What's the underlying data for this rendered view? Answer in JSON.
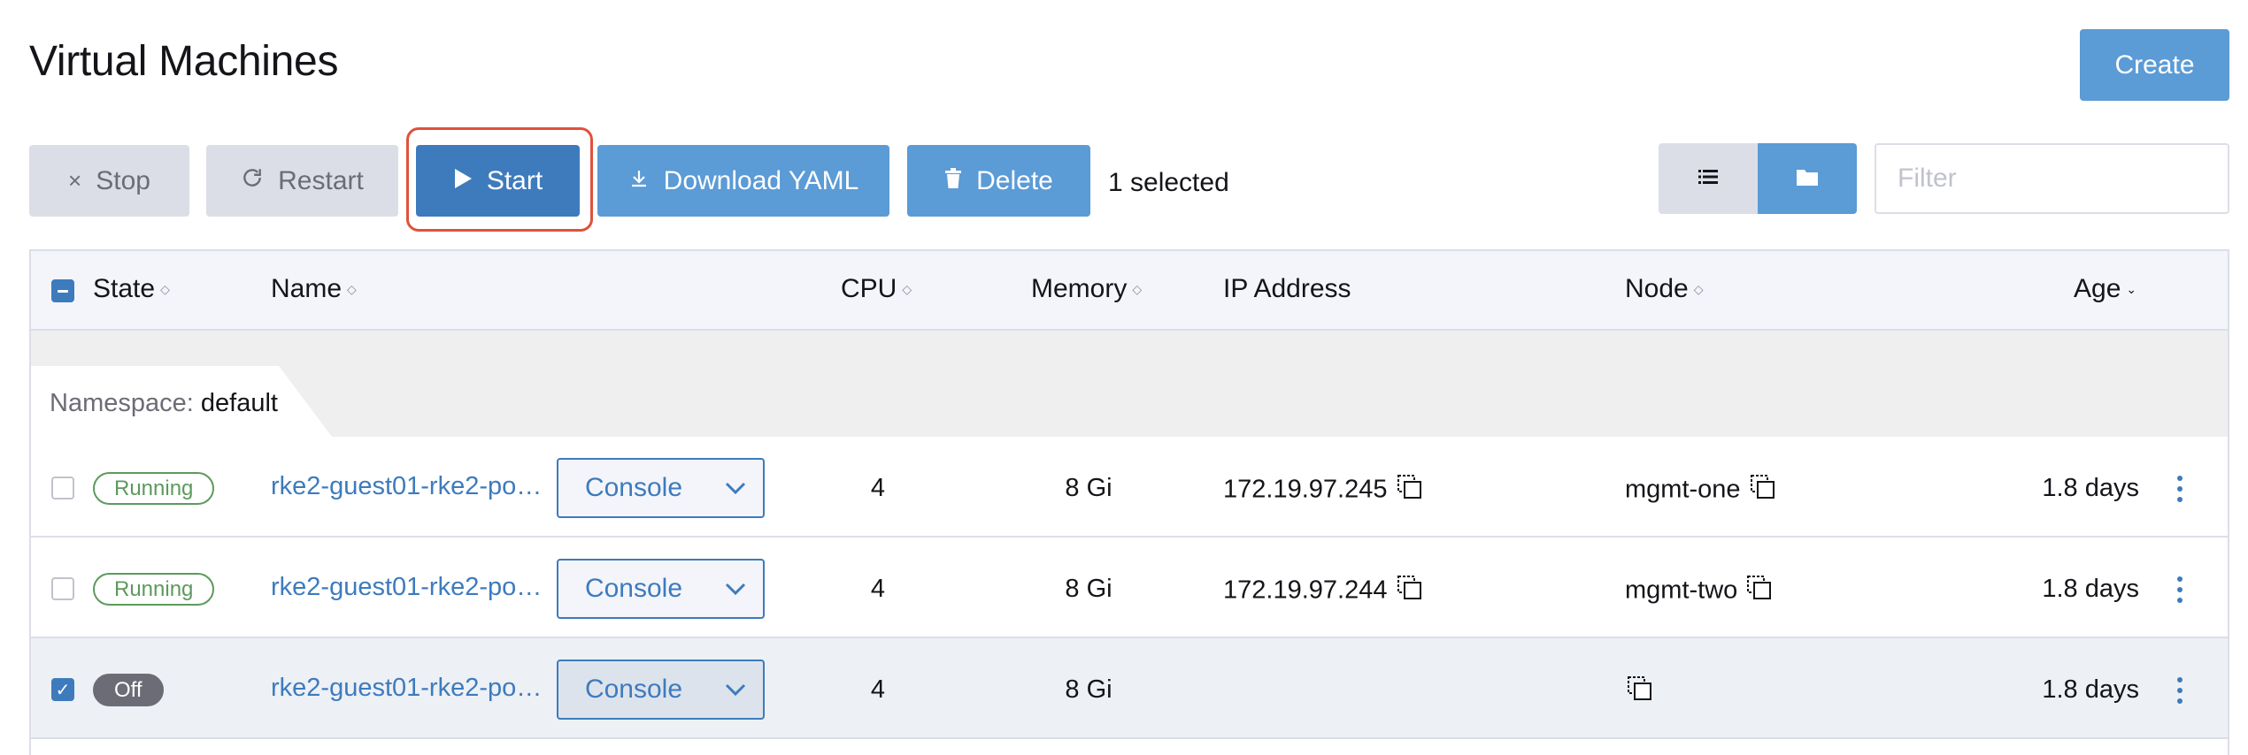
{
  "page": {
    "title": "Virtual Machines"
  },
  "header": {
    "create_label": "Create"
  },
  "toolbar": {
    "stop_label": "Stop",
    "restart_label": "Restart",
    "start_label": "Start",
    "download_yaml_label": "Download YAML",
    "delete_label": "Delete",
    "selected_text": "1 selected"
  },
  "filter": {
    "placeholder": "Filter",
    "value": ""
  },
  "table": {
    "columns": [
      "State",
      "Name",
      "CPU",
      "Memory",
      "IP Address",
      "Node",
      "Age"
    ],
    "group": {
      "prefix": "Namespace:",
      "name": "default"
    },
    "rows": [
      {
        "selected": false,
        "state": "Running",
        "name": "rke2-guest01-rke2-pool…",
        "console": "Console",
        "cpu": "4",
        "memory": "8 Gi",
        "ip": "172.19.97.245",
        "node": "mgmt-one",
        "age": "1.8 days"
      },
      {
        "selected": false,
        "state": "Running",
        "name": "rke2-guest01-rke2-pool…",
        "console": "Console",
        "cpu": "4",
        "memory": "8 Gi",
        "ip": "172.19.97.244",
        "node": "mgmt-two",
        "age": "1.8 days"
      },
      {
        "selected": true,
        "state": "Off",
        "name": "rke2-guest01-rke2-pool…",
        "console": "Console",
        "cpu": "4",
        "memory": "8 Gi",
        "ip": "",
        "node": "",
        "age": "1.8 days"
      }
    ]
  },
  "colors": {
    "primary": "#5b9bd6",
    "primary_dark": "#3d7bbd",
    "highlight": "#e0513b",
    "running": "#5d995d",
    "off": "#6c6c76"
  },
  "icons": [
    "close-icon",
    "refresh-icon",
    "play-icon",
    "download-icon",
    "trash-icon",
    "list-icon",
    "folder-icon",
    "copy-icon",
    "chevron-down-icon",
    "kebab-menu-icon",
    "sort-icon"
  ]
}
